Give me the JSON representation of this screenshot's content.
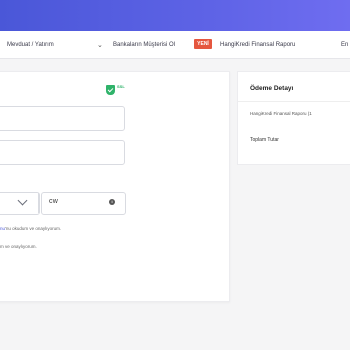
{
  "nav": {
    "item1": "Mevduat / Yatırım",
    "item2": "Bankaların Müşterisi Ol",
    "badge": "YENİ",
    "item3": "HangiKredi Finansal Raporu",
    "item4": "En"
  },
  "security": {
    "ssl_label": "SSL"
  },
  "form": {
    "cvv_value": "cw",
    "info_icon": "i",
    "consent1_link": "nu",
    "consent1_text": "'nu okudum ve onaylıyorum.",
    "consent2_text": "m ve onaylıyorum."
  },
  "summary": {
    "title": "Ödeme Detayı",
    "item": "HangiKredi Finansal Raporu (1",
    "total_label": "Toplam Tutar"
  },
  "colors": {
    "brand": "#4a57d8",
    "badge": "#e5573f",
    "ssl": "#2fb36a"
  },
  "icons": {
    "nav_chevron": "chevron-down-icon",
    "ssl": "ssl-shield-icon",
    "select_chevron": "chevron-down-icon",
    "info": "info-icon"
  }
}
